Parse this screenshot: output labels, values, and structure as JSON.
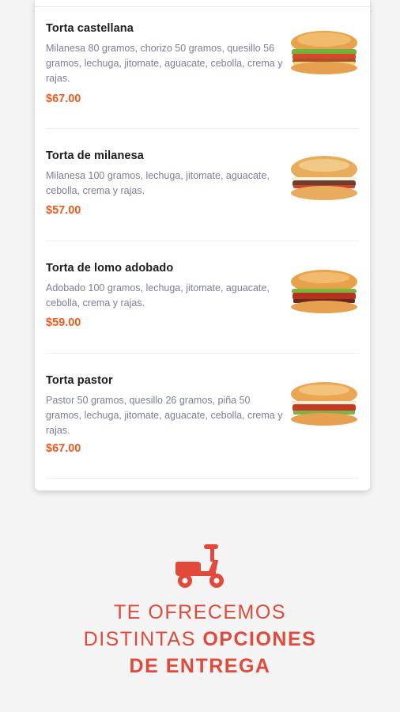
{
  "menu": {
    "items": [
      {
        "name": "Torta castellana",
        "description": "Milanesa 80 gramos, chorizo 50 gramos, quesillo 56 gramos, lechuga, jitomate, aguacate, cebolla, crema y rajas.",
        "price": "$67.00",
        "image": "sandwich-castellana"
      },
      {
        "name": "Torta de milanesa",
        "description": "Milanesa 100 gramos, lechuga, jitomate, aguacate, cebolla, crema y rajas.",
        "price": "$57.00",
        "image": "sandwich-milanesa"
      },
      {
        "name": "Torta de lomo adobado",
        "description": "Adobado 100 gramos, lechuga, jitomate, aguacate, cebolla, crema y rajas.",
        "price": "$59.00",
        "image": "sandwich-lomo"
      },
      {
        "name": "Torta pastor",
        "description": "Pastor 50 gramos, quesillo 26 gramos, piña 50 gramos, lechuga, jitomate, aguacate, cebolla, crema y rajas.",
        "price": "$67.00",
        "image": "sandwich-pastor"
      }
    ]
  },
  "promo": {
    "icon": "scooter-icon",
    "line1": "TE OFRECEMOS",
    "line2_light": "DISTINTAS",
    "line2_bold": "OPCIONES",
    "line3_bold": "DE ENTREGA"
  },
  "colors": {
    "accent": "#e14a3b",
    "price": "#f05a1c",
    "description": "#7b7f99"
  }
}
